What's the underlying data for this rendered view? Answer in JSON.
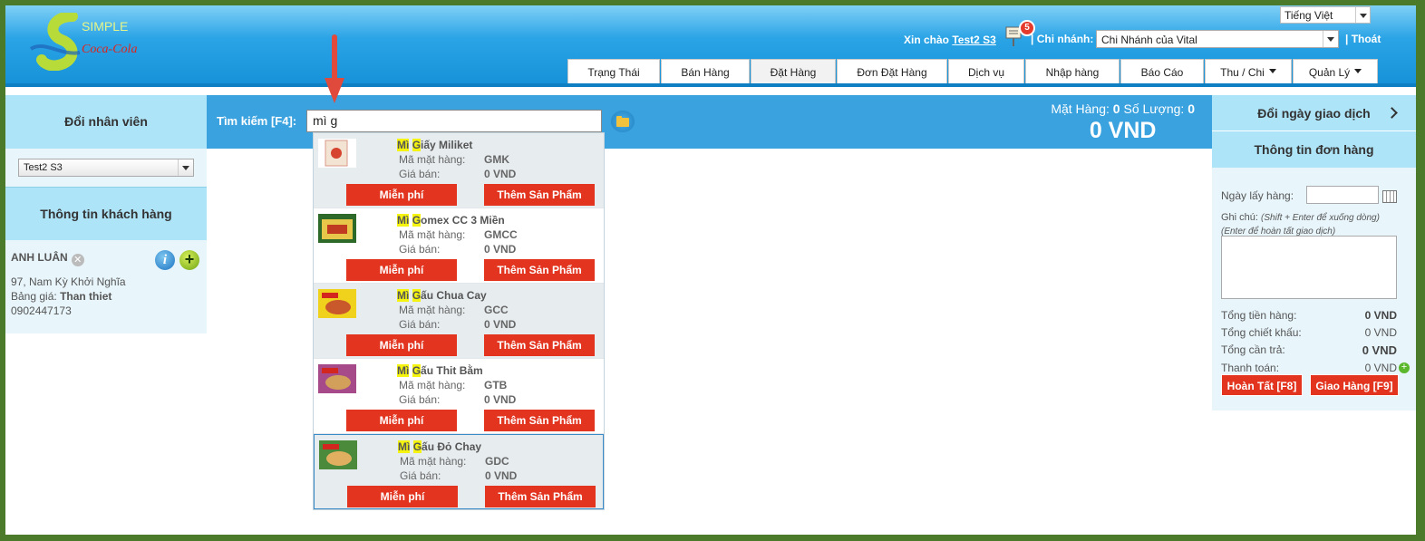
{
  "brand": {
    "simple": "SIMPLE",
    "coke": "Coca-Cola"
  },
  "header": {
    "language": "Tiếng Việt",
    "greeting": "Xin chào",
    "username": "Test2 S3",
    "notif_count": "5",
    "branch_label": "Chi nhánh:",
    "branch_value": "Chi Nhánh của Vital",
    "logout": "| Thoát",
    "separator": "|"
  },
  "nav": {
    "tabs": [
      {
        "label": "Trạng Thái"
      },
      {
        "label": "Bán Hàng"
      },
      {
        "label": "Đặt Hàng"
      },
      {
        "label": "Đơn Đặt Hàng"
      },
      {
        "label": "Dịch vụ"
      },
      {
        "label": "Nhập hàng"
      },
      {
        "label": "Báo Cáo"
      },
      {
        "label": "Thu / Chi"
      },
      {
        "label": "Quản Lý"
      }
    ]
  },
  "left": {
    "staff_title": "Đổi nhân viên",
    "staff_value": "Test2 S3",
    "customer_title": "Thông tin khách hàng",
    "customer_name": "ANH LUÂN",
    "address": "97, Nam Kỳ Khởi Nghĩa",
    "price_label": "Bảng giá:",
    "price_value": "Than thiet",
    "phone": "0902447173"
  },
  "search": {
    "label": "Tìm kiếm [F4]:",
    "value": "mì g",
    "items_label": "Mặt Hàng:",
    "items_count": "0",
    "qty_label": "Số Lượng:",
    "qty_count": "0",
    "total": "0 VND"
  },
  "results": {
    "code_label": "Mã mặt hàng:",
    "price_label": "Giá bán:",
    "free_label": "Miễn phí",
    "add_label": "Thêm Sản Phẩm",
    "items": [
      {
        "hl1": "Mì",
        "hl2": "G",
        "rest": "iấy Miliket",
        "code": "GMK",
        "price": "0 VND"
      },
      {
        "hl1": "Mì",
        "hl2": "G",
        "rest": "omex CC 3 Miền",
        "code": "GMCC",
        "price": "0 VND"
      },
      {
        "hl1": "Mì",
        "hl2": "G",
        "rest": "ấu Chua Cay",
        "code": "GCC",
        "price": "0 VND"
      },
      {
        "hl1": "Mì",
        "hl2": "G",
        "rest": "ấu Thit Bằm",
        "code": "GTB",
        "price": "0 VND"
      },
      {
        "hl1": "Mì",
        "hl2": "G",
        "rest": "ấu Đỏ Chay",
        "code": "GDC",
        "price": "0 VND"
      }
    ]
  },
  "right": {
    "change_date": "Đổi ngày giao dịch",
    "order_info": "Thông tin đơn hàng",
    "pickup_label": "Ngày lấy hàng:",
    "note_label": "Ghi chú:",
    "note_hint1": "(Shift + Enter để xuống dòng)",
    "note_hint2": "(Enter để hoàn tất giao dịch)",
    "subtotal_label": "Tổng tiền hàng:",
    "subtotal": "0 VND",
    "discount_label": "Tổng chiết khấu:",
    "discount": "0 VND",
    "due_label": "Tổng cần trả:",
    "due": "0 VND",
    "paid_label": "Thanh toán:",
    "paid": "0 VND",
    "complete_btn": "Hoàn Tất [F8]",
    "ship_btn": "Giao Hàng [F9]"
  }
}
